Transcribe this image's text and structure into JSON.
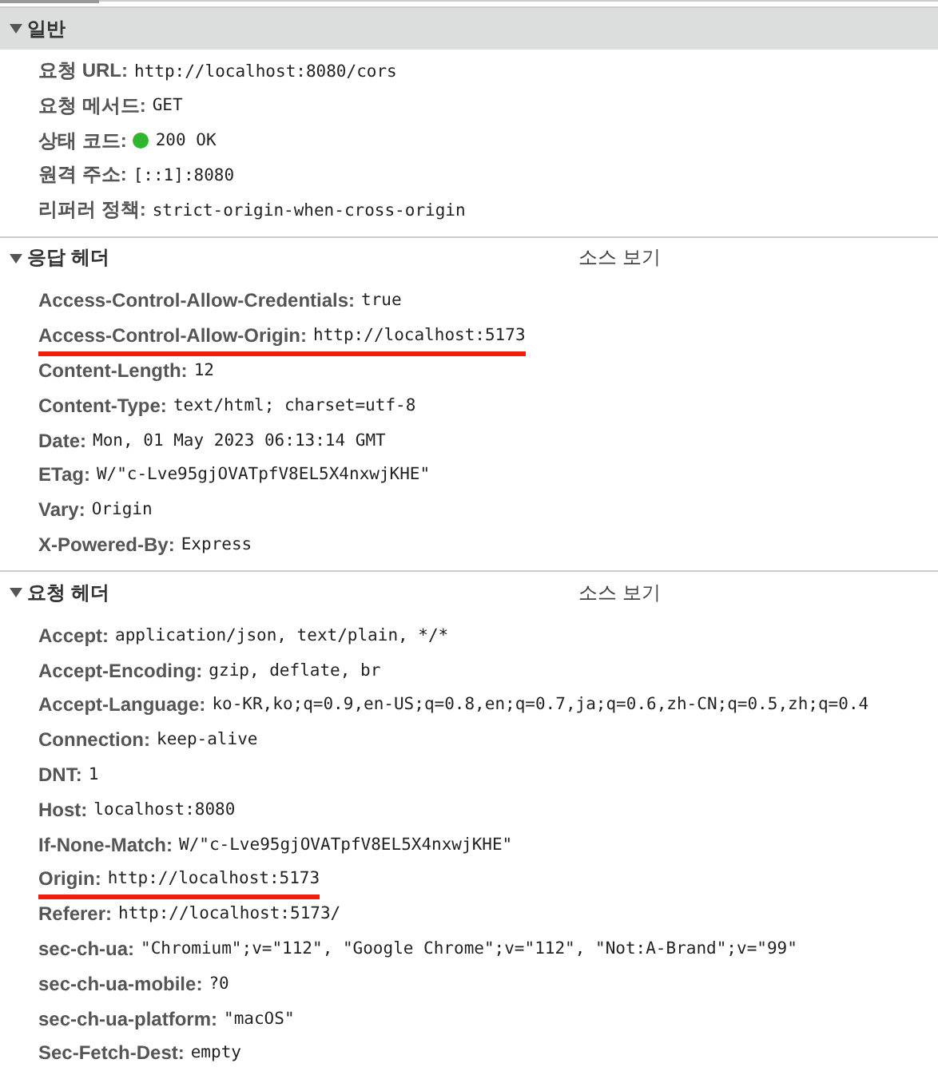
{
  "sections": [
    {
      "title": "일반",
      "kind": "summary",
      "expanded": true,
      "rows": [
        {
          "name": "요청 URL:",
          "value": "http://localhost:8080/cors",
          "underlined": false
        },
        {
          "name": "요청 메서드:",
          "value": "GET",
          "underlined": false
        },
        {
          "name": "상태 코드:",
          "value": "200 OK",
          "underlined": false,
          "color": "#2fb52f"
        },
        {
          "name": "원격 주소:",
          "value": "[::1]:8080",
          "underlined": false
        },
        {
          "name": "리퍼러 정책:",
          "value": "strict-origin-when-cross-origin",
          "underlined": false
        }
      ]
    },
    {
      "title": "응답 헤더",
      "kind": "headers",
      "expanded": true,
      "link": "소스 보기",
      "rows": [
        {
          "name": "Access-Control-Allow-Credentials:",
          "value": "true",
          "underlined": false
        },
        {
          "name": "Access-Control-Allow-Origin:",
          "value": "http://localhost:5173",
          "underlined": true
        },
        {
          "name": "Content-Length:",
          "value": "12",
          "underlined": false
        },
        {
          "name": "Content-Type:",
          "value": "text/html; charset=utf-8",
          "underlined": false
        },
        {
          "name": "Date:",
          "value": "Mon, 01 May 2023 06:13:14 GMT",
          "underlined": false
        },
        {
          "name": "ETag:",
          "value": "W/\"c-Lve95gjOVATpfV8EL5X4nxwjKHE\"",
          "underlined": false
        },
        {
          "name": "Vary:",
          "value": "Origin",
          "underlined": false
        },
        {
          "name": "X-Powered-By:",
          "value": "Express",
          "underlined": false
        }
      ]
    },
    {
      "title": "요청 헤더",
      "kind": "headers",
      "expanded": true,
      "link": "소스 보기",
      "rows": [
        {
          "name": "Accept:",
          "value": "application/json, text/plain, */*",
          "underlined": false
        },
        {
          "name": "Accept-Encoding:",
          "value": "gzip, deflate, br",
          "underlined": false
        },
        {
          "name": "Accept-Language:",
          "value": "ko-KR,ko;q=0.9,en-US;q=0.8,en;q=0.7,ja;q=0.6,zh-CN;q=0.5,zh;q=0.4",
          "underlined": false
        },
        {
          "name": "Connection:",
          "value": "keep-alive",
          "underlined": false
        },
        {
          "name": "DNT:",
          "value": "1",
          "underlined": false
        },
        {
          "name": "Host:",
          "value": "localhost:8080",
          "underlined": false
        },
        {
          "name": "If-None-Match:",
          "value": "W/\"c-Lve95gjOVATpfV8EL5X4nxwjKHE\"",
          "underlined": false
        },
        {
          "name": "Origin:",
          "value": "http://localhost:5173",
          "underlined": true
        },
        {
          "name": "Referer:",
          "value": "http://localhost:5173/",
          "underlined": false
        },
        {
          "name": "sec-ch-ua:",
          "value": "\"Chromium\";v=\"112\", \"Google Chrome\";v=\"112\", \"Not:A-Brand\";v=\"99\"",
          "underlined": false
        },
        {
          "name": "sec-ch-ua-mobile:",
          "value": "?0",
          "underlined": false
        },
        {
          "name": "sec-ch-ua-platform:",
          "value": "\"macOS\"",
          "underlined": false
        },
        {
          "name": "Sec-Fetch-Dest:",
          "value": "empty",
          "underlined": false
        }
      ]
    }
  ]
}
